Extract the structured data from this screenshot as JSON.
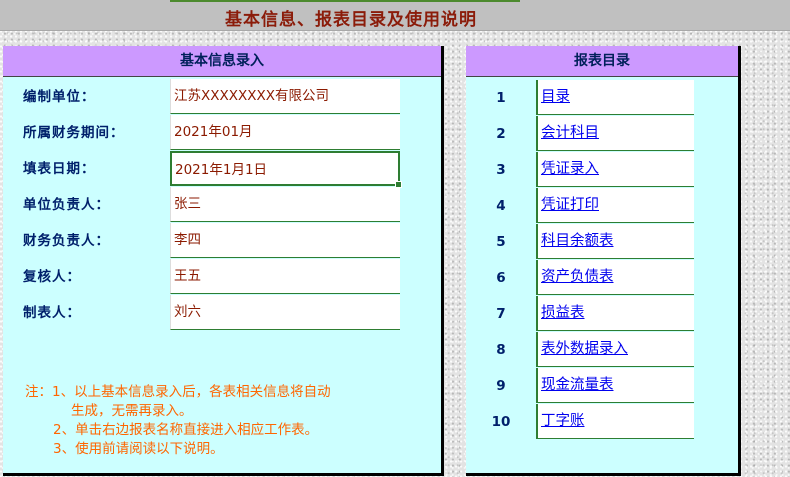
{
  "page": {
    "title": "基本信息、报表目录及使用说明"
  },
  "info_panel": {
    "header": "基本信息录入",
    "fields": [
      {
        "label": "编制单位：",
        "value": "江苏XXXXXXXX有限公司"
      },
      {
        "label": "所属财务期间：",
        "value": "2021年01月"
      },
      {
        "label": "填表日期：",
        "value": "2021年1月1日"
      },
      {
        "label": "单位负责人：",
        "value": "张三"
      },
      {
        "label": "财务负责人：",
        "value": "李四"
      },
      {
        "label": "复核人：",
        "value": "王五"
      },
      {
        "label": "制表人：",
        "value": "刘六"
      }
    ],
    "notes": [
      "注：1、以上基本信息录入后，各表相关信息将自动",
      "生成，无需再录入。",
      "2、单击右边报表名称直接进入相应工作表。",
      "3、使用前请阅读以下说明。"
    ]
  },
  "directory_panel": {
    "header": "报表目录",
    "items": [
      {
        "num": "1",
        "name": "目录"
      },
      {
        "num": "2",
        "name": "会计科目"
      },
      {
        "num": "3",
        "name": "凭证录入"
      },
      {
        "num": "4",
        "name": "凭证打印"
      },
      {
        "num": "5",
        "name": "科目余额表"
      },
      {
        "num": "6",
        "name": "资产负债表"
      },
      {
        "num": "7",
        "name": "损益表"
      },
      {
        "num": "8",
        "name": "表外数据录入"
      },
      {
        "num": "9",
        "name": "现金流量表"
      },
      {
        "num": "10",
        "name": "丁字账"
      }
    ]
  },
  "colors": {
    "panel_bg": "#ccffff",
    "header_bg": "#cc99ff",
    "title_color": "#8b1c0a",
    "value_color": "#8b1a00",
    "note_color": "#ff6600",
    "link_color": "#0000ee",
    "cell_border": "#2e7d32"
  }
}
